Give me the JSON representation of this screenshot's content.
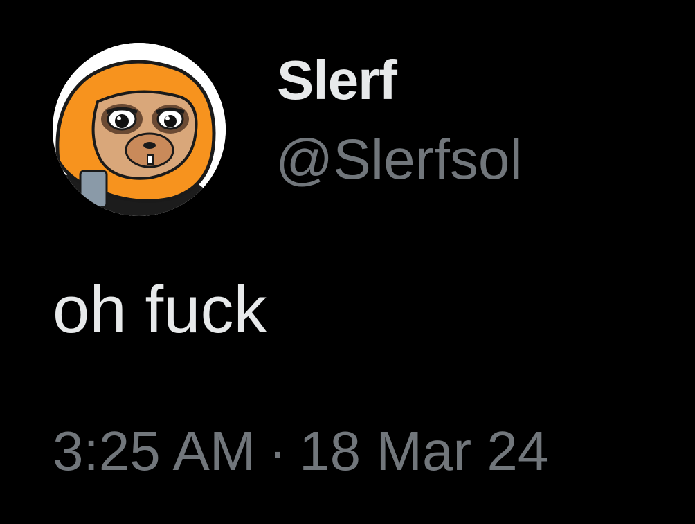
{
  "author": {
    "display_name": "Slerf",
    "handle": "@Slerfsol",
    "avatar_icon": "sloth-avatar-icon"
  },
  "tweet": {
    "text": "oh fuck",
    "time": "3:25 AM",
    "separator": "·",
    "date": "18 Mar 24"
  },
  "colors": {
    "background": "#000000",
    "primary_text": "#e7e9ea",
    "secondary_text": "#71767b",
    "avatar_hood": "#f7931e"
  }
}
